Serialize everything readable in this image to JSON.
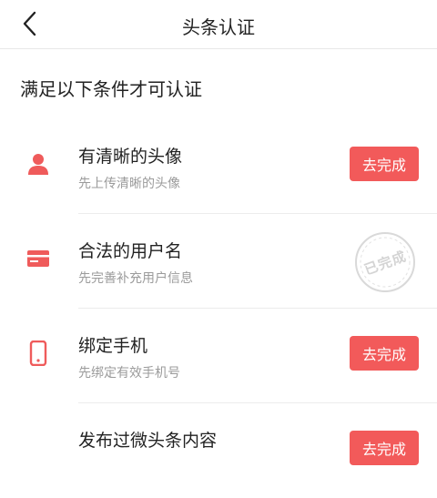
{
  "header": {
    "title": "头条认证",
    "back_icon": "chevron-left-icon"
  },
  "intro": "满足以下条件才可认证",
  "accent": "#f25a5a",
  "conditions": [
    {
      "name": "有清晰的头像",
      "desc": "先上传清晰的头像",
      "icon": "person-icon",
      "status": "pending",
      "action_label": "去完成"
    },
    {
      "name": "合法的用户名",
      "desc": "先完善补充用户信息",
      "icon": "id-card-icon",
      "status": "completed",
      "stamp_label": "已完成"
    },
    {
      "name": "绑定手机",
      "desc": "先绑定有效手机号",
      "icon": "phone-icon",
      "status": "pending",
      "action_label": "去完成"
    },
    {
      "name": "发布过微头条内容",
      "desc": "",
      "icon": "post-icon",
      "status": "pending",
      "action_label": "去完成"
    }
  ]
}
